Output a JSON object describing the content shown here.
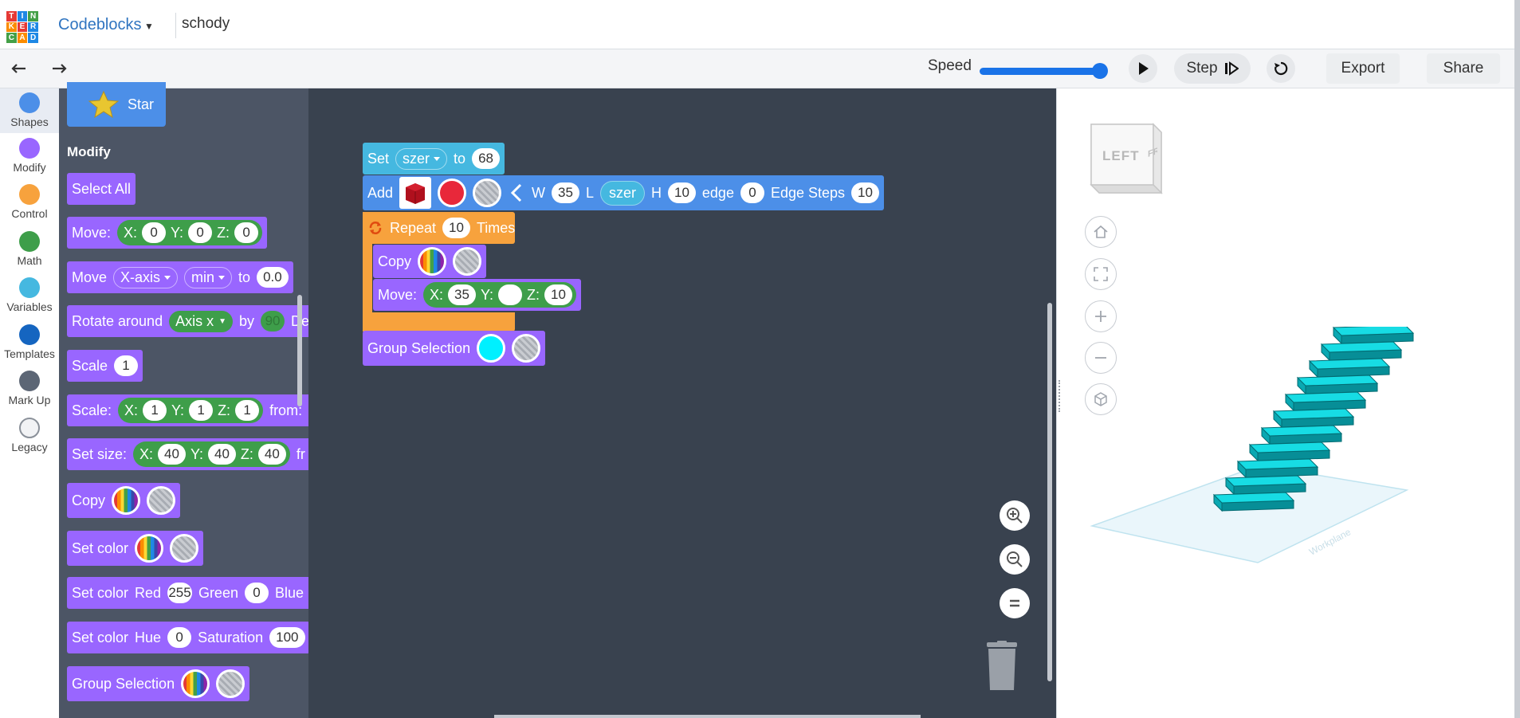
{
  "header": {
    "logo_letters": [
      "T",
      "I",
      "N",
      "K",
      "E",
      "R",
      "C",
      "A",
      "D"
    ],
    "app_name": "Codeblocks",
    "design_name": "schody"
  },
  "toolbar": {
    "speed_label": "Speed",
    "speed_value": 1.0,
    "step_label": "Step",
    "export_label": "Export",
    "share_label": "Share"
  },
  "categories": [
    {
      "label": "Shapes",
      "color": "#4c8fe8"
    },
    {
      "label": "Modify",
      "color": "#9966ff"
    },
    {
      "label": "Control",
      "color": "#f7a23d"
    },
    {
      "label": "Math",
      "color": "#3e9e4a"
    },
    {
      "label": "Variables",
      "color": "#45b8e0"
    },
    {
      "label": "Templates",
      "color": "#1565c0"
    },
    {
      "label": "Mark Up",
      "color": "#5c6675"
    },
    {
      "label": "Legacy",
      "color": "#f2f3f5"
    }
  ],
  "palette": {
    "star_label": "Star",
    "modify_heading": "Modify",
    "select_all": "Select All",
    "move_label": "Move:",
    "move_x": "X:",
    "move_x_val": "0",
    "move_y": "Y:",
    "move_y_val": "0",
    "move_z": "Z:",
    "move_z_val": "0",
    "move_axis_label": "Move",
    "move_axis_dd": "X-axis",
    "move_axis_min": "min",
    "move_axis_to": "to",
    "move_axis_val": "0.0",
    "rotate_label": "Rotate around",
    "rotate_axis": "Axis x",
    "rotate_by": "by",
    "rotate_val": "90",
    "rotate_unit": "De",
    "scale_label": "Scale",
    "scale_val": "1",
    "scale3_label": "Scale:",
    "scale3_x": "X:",
    "scale3_x_val": "1",
    "scale3_y": "Y:",
    "scale3_y_val": "1",
    "scale3_z": "Z:",
    "scale3_z_val": "1",
    "scale3_from": "from:",
    "setsize_label": "Set size:",
    "setsize_x": "X:",
    "setsize_x_val": "40",
    "setsize_y": "Y:",
    "setsize_y_val": "40",
    "setsize_z": "Z:",
    "setsize_z_val": "40",
    "setsize_fr": "fr",
    "copy_label": "Copy",
    "setcolor_label": "Set color",
    "setcolor_rgb_label": "Set color",
    "rgb_red": "Red",
    "rgb_red_val": "255",
    "rgb_green": "Green",
    "rgb_green_val": "0",
    "rgb_blue": "Blue",
    "setcolor_hsv_label": "Set color",
    "hsv_hue": "Hue",
    "hsv_hue_val": "0",
    "hsv_sat": "Saturation",
    "hsv_sat_val": "100",
    "group_label": "Group Selection"
  },
  "program": {
    "set_label": "Set",
    "set_var": "szer",
    "set_to": "to",
    "set_val": "68",
    "add_label": "Add",
    "add_w": "W",
    "add_w_val": "35",
    "add_l": "L",
    "add_l_var": "szer",
    "add_h": "H",
    "add_h_val": "10",
    "add_edge": "edge",
    "add_edge_val": "0",
    "add_steps": "Edge Steps",
    "add_steps_val": "10",
    "repeat_label": "Repeat",
    "repeat_val": "10",
    "repeat_times": "Times",
    "copy_label": "Copy",
    "move_label": "Move:",
    "move_x": "X:",
    "move_x_val": "35",
    "move_y": "Y:",
    "move_y_val": "",
    "move_z": "Z:",
    "move_z_val": "10",
    "group_label": "Group Selection"
  },
  "viewer": {
    "cube_left": "LEFT",
    "cube_front": "FRO",
    "workplane_label": "Workplane"
  },
  "colors": {
    "accent": "#1a73e8",
    "shape_red": "#e8283a",
    "stair_cyan": "#14d4dc",
    "group_cyan": "#00f0ff"
  }
}
